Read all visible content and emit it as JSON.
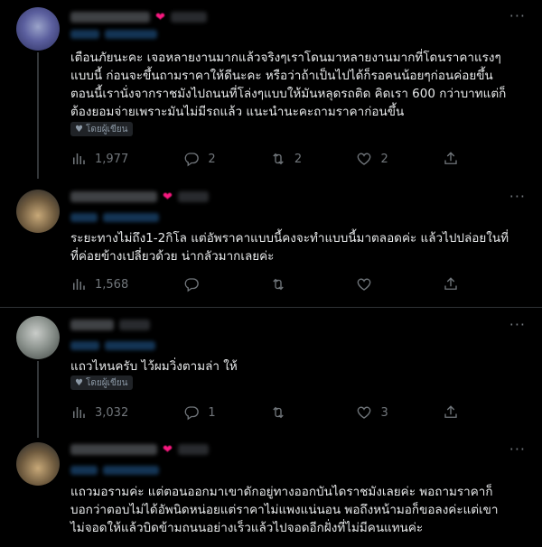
{
  "tweets": [
    {
      "text": "เตือนภัยนะคะ เจอหลายงานมากแล้วจริงๆเราโดนมาหลายงานมากที่โดนราคาแรงๆ\nแบบนี้ ก่อนจะขึ้นถามราคาให้ดีนะคะ หรือว่าถ้าเป็นไปได้ก็รอคนน้อยๆก่อนค่อยขึ้น\nตอนนี้เรานั่งจากราชมังไปถนนที่โล่งๆแบบให้มันหลุดรถติด คิดเรา 600 กว่าบาทแต่ก็\nต้องยอมจ่ายเพราะมันไม่มีรถแล้ว แนะนำนะคะถามราคาก่อนขึ้น",
      "author_liked": "โดยผู้เขียน",
      "views": "1,977",
      "replies": "2",
      "retweets": "2",
      "likes": "2"
    },
    {
      "text": "ระยะทางไม่ถึง1-2กิโล แต่อัพราคาแบบนี้คงจะทำแบบนี้มาตลอดค่ะ แล้วไปปล่อยในที่\nที่ค่อยข้างเปลี่ยวด้วย น่ากลัวมากเลยค่ะ",
      "views": "1,568",
      "replies": "",
      "retweets": "",
      "likes": ""
    },
    {
      "text": "แถวไหนครับ ไว้ผมวิ่งตามล่า ให้",
      "author_liked": "โดยผู้เขียน",
      "views": "3,032",
      "replies": "1",
      "retweets": "",
      "likes": "3"
    },
    {
      "text": "แถวมอรามค่ะ แต่ตอนออกมาเขาดักอยู่ทางออกบันไดราชมังเลยค่ะ พอถามราคาก็\nบอกว่าตอบไม่ได้อัพนิดหน่อยแต่ราคาไม่แพงแน่นอน พอถึงหน้ามอก็ขอลงค่ะแต่เขา\nไม่จอดให้แล้วบิดข้ามถนนอย่างเร็วแล้วไปจอดอีกฝั่งที่ไม่มีคนแทนค่ะ"
    }
  ]
}
